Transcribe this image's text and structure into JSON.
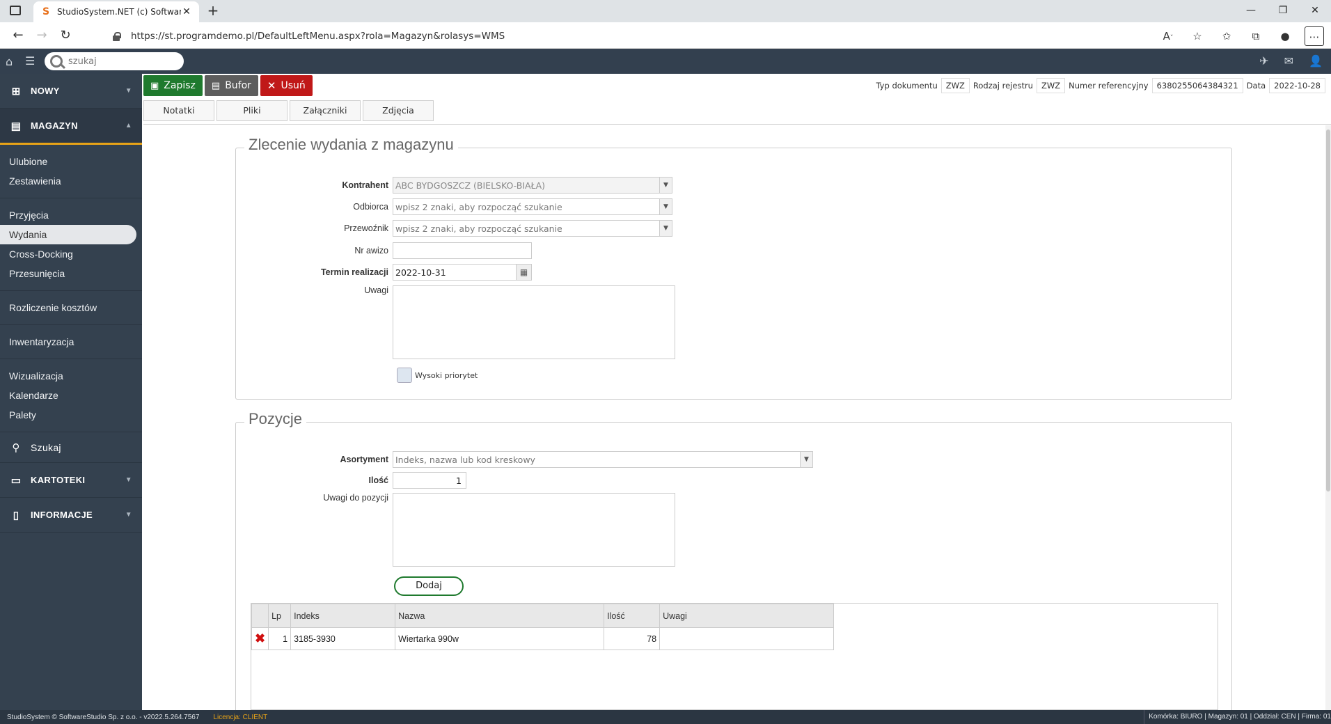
{
  "browser": {
    "tab_title": "StudioSystem.NET (c) SoftwareSt",
    "favicon_char": "S",
    "url": "https://st.programdemo.pl/DefaultLeftMenu.aspx?rola=Magazyn&rolasys=WMS"
  },
  "topbar": {
    "search_placeholder": "szukaj"
  },
  "sidebar": {
    "nowy": "NOWY",
    "magazyn": "MAGAZYN",
    "group1": [
      "Ulubione",
      "Zestawienia"
    ],
    "group2": [
      "Przyjęcia",
      "Wydania",
      "Cross-Docking",
      "Przesunięcia"
    ],
    "group3": [
      "Rozliczenie kosztów"
    ],
    "group4": [
      "Inwentaryzacja"
    ],
    "group5": [
      "Wizualizacja",
      "Kalendarze",
      "Palety"
    ],
    "szukaj": "Szukaj",
    "kartoteki": "KARTOTEKI",
    "informacje": "INFORMACJE"
  },
  "toolbar": {
    "save": "Zapisz",
    "buffer": "Bufor",
    "delete": "Usuń"
  },
  "subtabs": [
    "Notatki",
    "Pliki",
    "Załączniki",
    "Zdjęcia"
  ],
  "doc_meta": {
    "typ_label": "Typ dokumentu",
    "typ_value": "ZWZ",
    "rodzaj_label": "Rodzaj rejestru",
    "rodzaj_value": "ZWZ",
    "numer_label": "Numer referencyjny",
    "numer_value": "6380255064384321",
    "data_label": "Data",
    "data_value": "2022-10-28"
  },
  "form": {
    "legend": "Zlecenie wydania z magazynu",
    "kontrahent_label": "Kontrahent",
    "kontrahent_value": "ABC BYDGOSZCZ (BIELSKO-BIAŁA)",
    "odbiorca_label": "Odbiorca",
    "odbiorca_placeholder": "wpisz 2 znaki, aby rozpocząć szukanie",
    "przewoznik_label": "Przewoźnik",
    "przewoznik_placeholder": "wpisz 2 znaki, aby rozpocząć szukanie",
    "nr_awizo_label": "Nr awizo",
    "nr_awizo_value": "",
    "termin_label": "Termin realizacji",
    "termin_value": "2022-10-31",
    "uwagi_label": "Uwagi",
    "priorytet_label": "Wysoki priorytet"
  },
  "pozycje": {
    "legend": "Pozycje",
    "asortyment_label": "Asortyment",
    "asortyment_placeholder": "Indeks, nazwa lub kod kreskowy",
    "ilosc_label": "Ilość",
    "ilosc_value": "1",
    "uwagi_label": "Uwagi do pozycji",
    "dodaj": "Dodaj"
  },
  "table": {
    "headers": [
      "Lp",
      "Indeks",
      "Nazwa",
      "Ilość",
      "Uwagi"
    ],
    "rows": [
      {
        "lp": "1",
        "indeks": "3185-3930",
        "nazwa": "Wiertarka 990w",
        "ilosc": "78",
        "uwagi": ""
      }
    ]
  },
  "status": {
    "left": "StudioSystem © SoftwareStudio Sp. z o.o. - v2022.5.264.7567",
    "license": "Licencja: CLIENT",
    "right": "Komórka: BIURO | Magazyn: 01 | Oddział: CEN | Firma: 01"
  }
}
